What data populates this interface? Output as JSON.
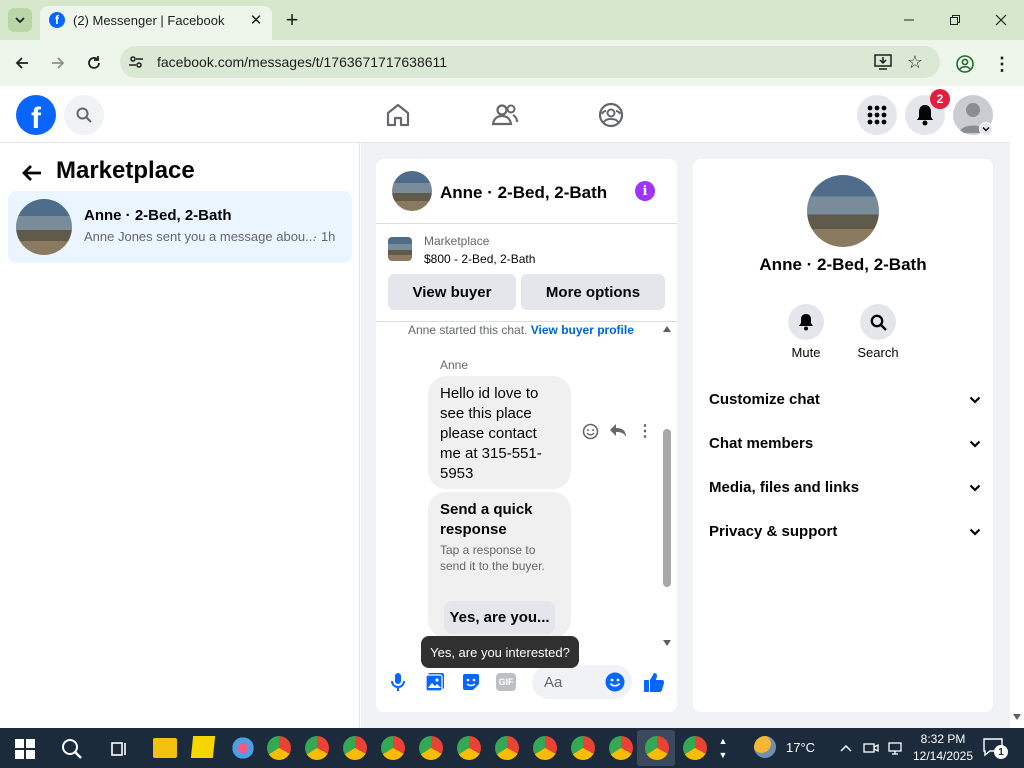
{
  "browser": {
    "tab_title": "(2) Messenger | Facebook",
    "url": "facebook.com/messages/t/1763671717638611"
  },
  "header": {
    "notification_count": "2"
  },
  "left": {
    "title": "Marketplace",
    "conversation": {
      "name": "Anne · 2-Bed, 2-Bath",
      "preview": "Anne Jones sent you a message abou...",
      "time": "· 1h"
    }
  },
  "chat": {
    "title": "Anne · 2-Bed, 2-Bath",
    "listing_label": "Marketplace",
    "listing_detail": "$800 - 2-Bed, 2-Bath",
    "view_buyer": "View buyer",
    "more_options": "More options",
    "started_text": "Anne started this chat.",
    "view_buyer_profile": "View buyer profile",
    "sender": "Anne",
    "message": "Hello id love to see this place please contact me at 315-551-5953",
    "quick_title": "Send a quick response",
    "quick_desc": "Tap a response to send it to the buyer.",
    "quick_option": "Yes, are you...",
    "tooltip": "Yes, are you interested?",
    "composer_placeholder": "Aa"
  },
  "info": {
    "name": "Anne · 2-Bed, 2-Bath",
    "mute": "Mute",
    "search": "Search",
    "sections": [
      "Customize chat",
      "Chat members",
      "Media, files and links",
      "Privacy & support"
    ]
  },
  "taskbar": {
    "temperature": "17°C",
    "time": "8:32 PM",
    "date": "12/14/2025",
    "notif": "1"
  },
  "colors": {
    "fb_blue": "#0866ff",
    "accent_purple": "#a033ff",
    "notif_red": "#e41e3f"
  }
}
